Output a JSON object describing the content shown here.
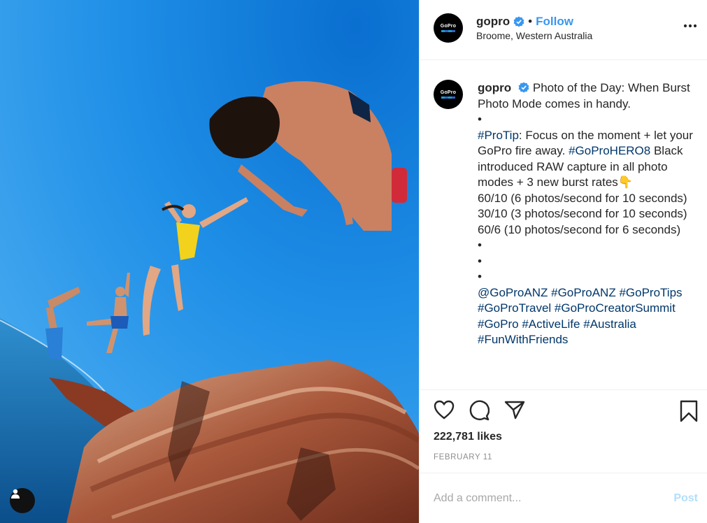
{
  "post": {
    "author": "gopro",
    "avatar_logo": "GoPro",
    "follow_label": "Follow",
    "separator": "•",
    "location": "Broome, Western Australia"
  },
  "caption": {
    "lines": [
      "Photo of the Day: When Burst Photo Mode comes in handy.",
      "•",
      "#ProTip",
      ": Focus on the moment + let your GoPro fire away. ",
      "#GoProHERO8",
      " Black introduced RAW capture in all photo modes + 3 new burst rates👇",
      "60/10 (6 photos/second for 10 seconds)",
      "30/10 (3 photos/second for 10 seconds)",
      "60/6 (10 photos/second for 6 seconds)",
      "•",
      "•",
      "•",
      "@GoProANZ",
      "#GoProANZ",
      "#GoProTips",
      "#GoProTravel",
      "#GoProCreatorSummit",
      "#GoPro",
      "#ActiveLife",
      "#Australia",
      "#FunWithFriends"
    ]
  },
  "stats": {
    "likes": "222,781 likes",
    "date": "FEBRUARY 11"
  },
  "comment": {
    "placeholder": "Add a comment...",
    "post_label": "Post"
  },
  "icons": [
    "verified-badge-icon",
    "more-options-icon",
    "heart-icon",
    "comment-icon",
    "share-icon",
    "bookmark-icon",
    "user-tag-icon"
  ],
  "colors": {
    "link": "#3897f0",
    "hashtag": "#00376b",
    "muted": "#8e8e8e",
    "post_disabled": "#b2dffc"
  }
}
